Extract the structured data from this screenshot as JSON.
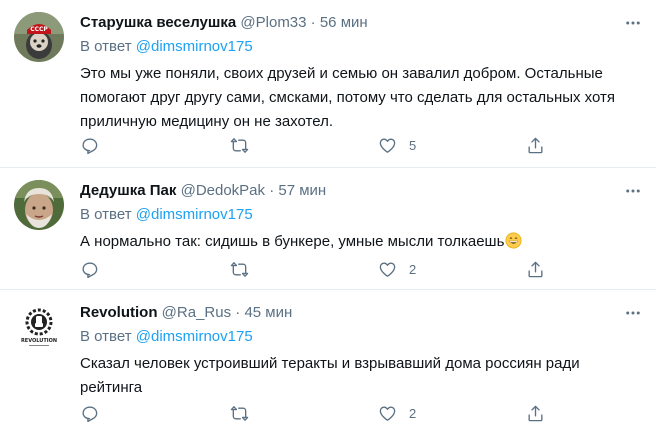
{
  "colors": {
    "name": "#0f1419",
    "secondary": "#5b7083",
    "link": "#1da1f2",
    "divider": "#e6ecf0"
  },
  "tweets": [
    {
      "name": "Старушка веселушка",
      "handle": "@Plom33",
      "separator": "·",
      "time": "56 мин",
      "reply_prefix": "В ответ",
      "reply_to": "@dimsmirnov175",
      "text": "Это мы уже поняли, своих друзей и семью он завалил добром. Остальные помогают друг другу сами, смсками, потому что сделать для остальных хотя приличную медицину он не захотел.",
      "avatar_label": "СССР",
      "reply_count": "",
      "retweet_count": "",
      "like_count": "5"
    },
    {
      "name": "Дедушка Пак",
      "handle": "@DedokPak",
      "separator": "·",
      "time": "57 мин",
      "reply_prefix": "В ответ",
      "reply_to": "@dimsmirnov175",
      "text": "А нормально так: сидишь в бункере, умные мысли толкаешь",
      "emoji": "grinning-face-icon",
      "reply_count": "",
      "retweet_count": "",
      "like_count": "2"
    },
    {
      "name": "Revolution",
      "handle": "@Ra_Rus",
      "separator": "·",
      "time": "45 мин",
      "reply_prefix": "В ответ",
      "reply_to": "@dimsmirnov175",
      "text": "Сказал человек устроивший теракты и взрывавший дома россиян ради рейтинга",
      "avatar_label": "REVOLUTION",
      "reply_count": "",
      "retweet_count": "",
      "like_count": "2"
    }
  ]
}
